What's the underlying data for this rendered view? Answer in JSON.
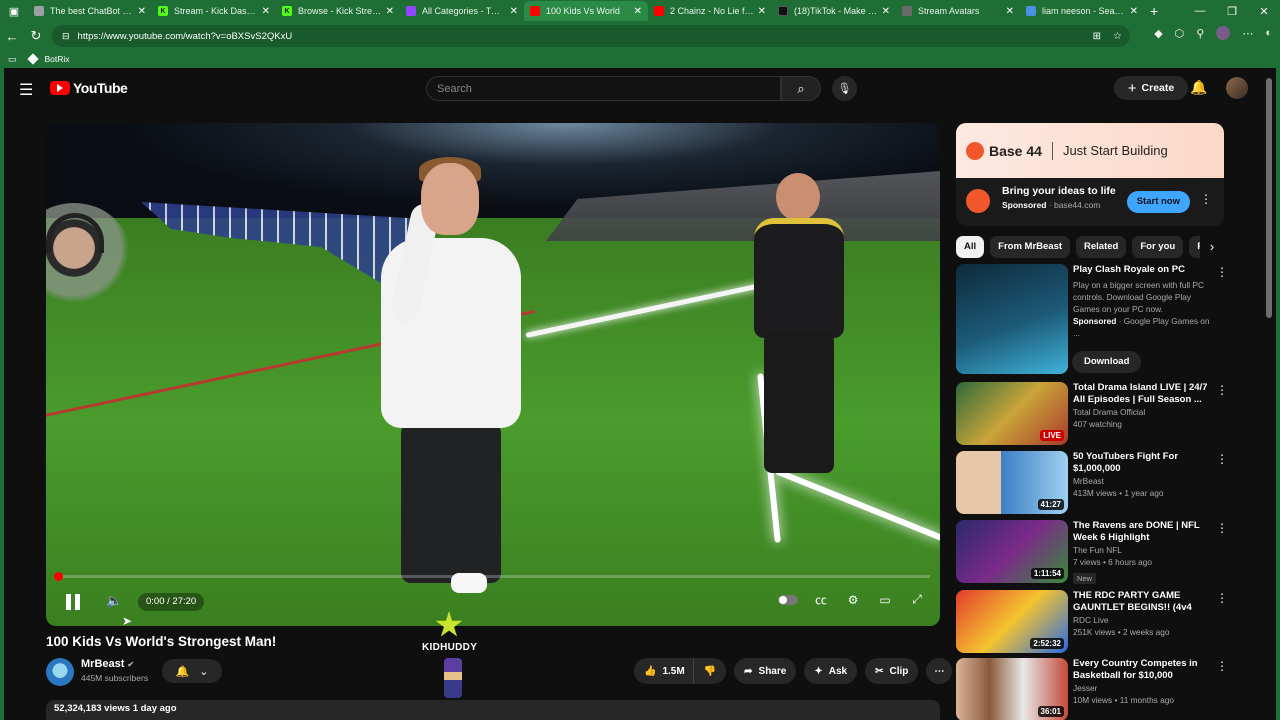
{
  "browser": {
    "tabs": [
      {
        "label": "The best ChatBot and",
        "fav_color": "#9aa0a6",
        "fav": ""
      },
      {
        "label": "Stream - Kick Dashboa",
        "fav_color": "#53fc18",
        "fav": "K"
      },
      {
        "label": "Browse - Kick Streamin",
        "fav_color": "#53fc18",
        "fav": "K"
      },
      {
        "label": "All Categories - Twitch",
        "fav_color": "#9146ff",
        "fav": ""
      },
      {
        "label": "100 Kids Vs World",
        "fav_color": "#ff0000",
        "fav": ""
      },
      {
        "label": "2 Chainz - No Lie ft. D",
        "fav_color": "#ff0000",
        "fav": ""
      },
      {
        "label": "(18)TikTok - Make You",
        "fav_color": "#111111",
        "fav": ""
      },
      {
        "label": "Stream Avatars",
        "fav_color": "#6a6a6a",
        "fav": ""
      },
      {
        "label": "liam neeson - Search",
        "fav_color": "#4a90e2",
        "fav": ""
      }
    ],
    "url": "https://www.youtube.com/watch?v=oBXSvS2QKxU",
    "bookmark": "BotRix"
  },
  "header": {
    "logo": "YouTube",
    "search_placeholder": "Search",
    "create_label": "Create"
  },
  "player": {
    "time": "0:00 / 27:20",
    "progress": 0.0
  },
  "video": {
    "title": "100 Kids Vs World's Strongest Man!",
    "channel": "MrBeast",
    "subscribers": "445M subscribers",
    "likes": "1.5M",
    "share": "Share",
    "ask": "Ask",
    "clip": "Clip",
    "views_date": "52,324,183 views  1 day ago",
    "overlay_name": "KIDHUDDY"
  },
  "ad": {
    "brand": "Base 44",
    "tagline": "Just Start Building",
    "title": "Bring your ideas to life",
    "sponsored": "Sponsored",
    "domain": "base44.com",
    "cta": "Start now"
  },
  "chips": [
    "All",
    "From MrBeast",
    "Related",
    "For you",
    "R"
  ],
  "recommendations": [
    {
      "title": "Play Clash Royale on PC",
      "line1": "Play on a bigger screen with full PC controls. Download Google Play Games on your PC now.",
      "line2": "Sponsored",
      "line2b": "Google Play Games on ...",
      "button": "Download",
      "kind": "ad"
    },
    {
      "title": "Total Drama Island LIVE | 24/7 All Episodes | Full Season ...",
      "channel": "Total Drama Official",
      "meta": "407 watching",
      "badge": "LIVE"
    },
    {
      "title": "50 YouTubers Fight For $1,000,000",
      "channel": "MrBeast",
      "meta": "413M views • 1 year ago",
      "badge": "41:27"
    },
    {
      "title": "The Ravens are DONE | NFL Week 6 Highlight",
      "channel": "The Fun NFL",
      "meta": "7 views • 6 hours ago",
      "extra": "New",
      "badge": "1:11:54"
    },
    {
      "title": "THE RDC PARTY GAME GAUNTLET BEGINS!! (4v4 Mar...",
      "channel": "RDC Live",
      "meta": "251K views • 2 weeks ago",
      "badge": "2:52:32"
    },
    {
      "title": "Every Country Competes in Basketball for $10,000",
      "channel": "Jesser",
      "meta": "10M views • 11 months ago",
      "badge": "36:01"
    }
  ]
}
